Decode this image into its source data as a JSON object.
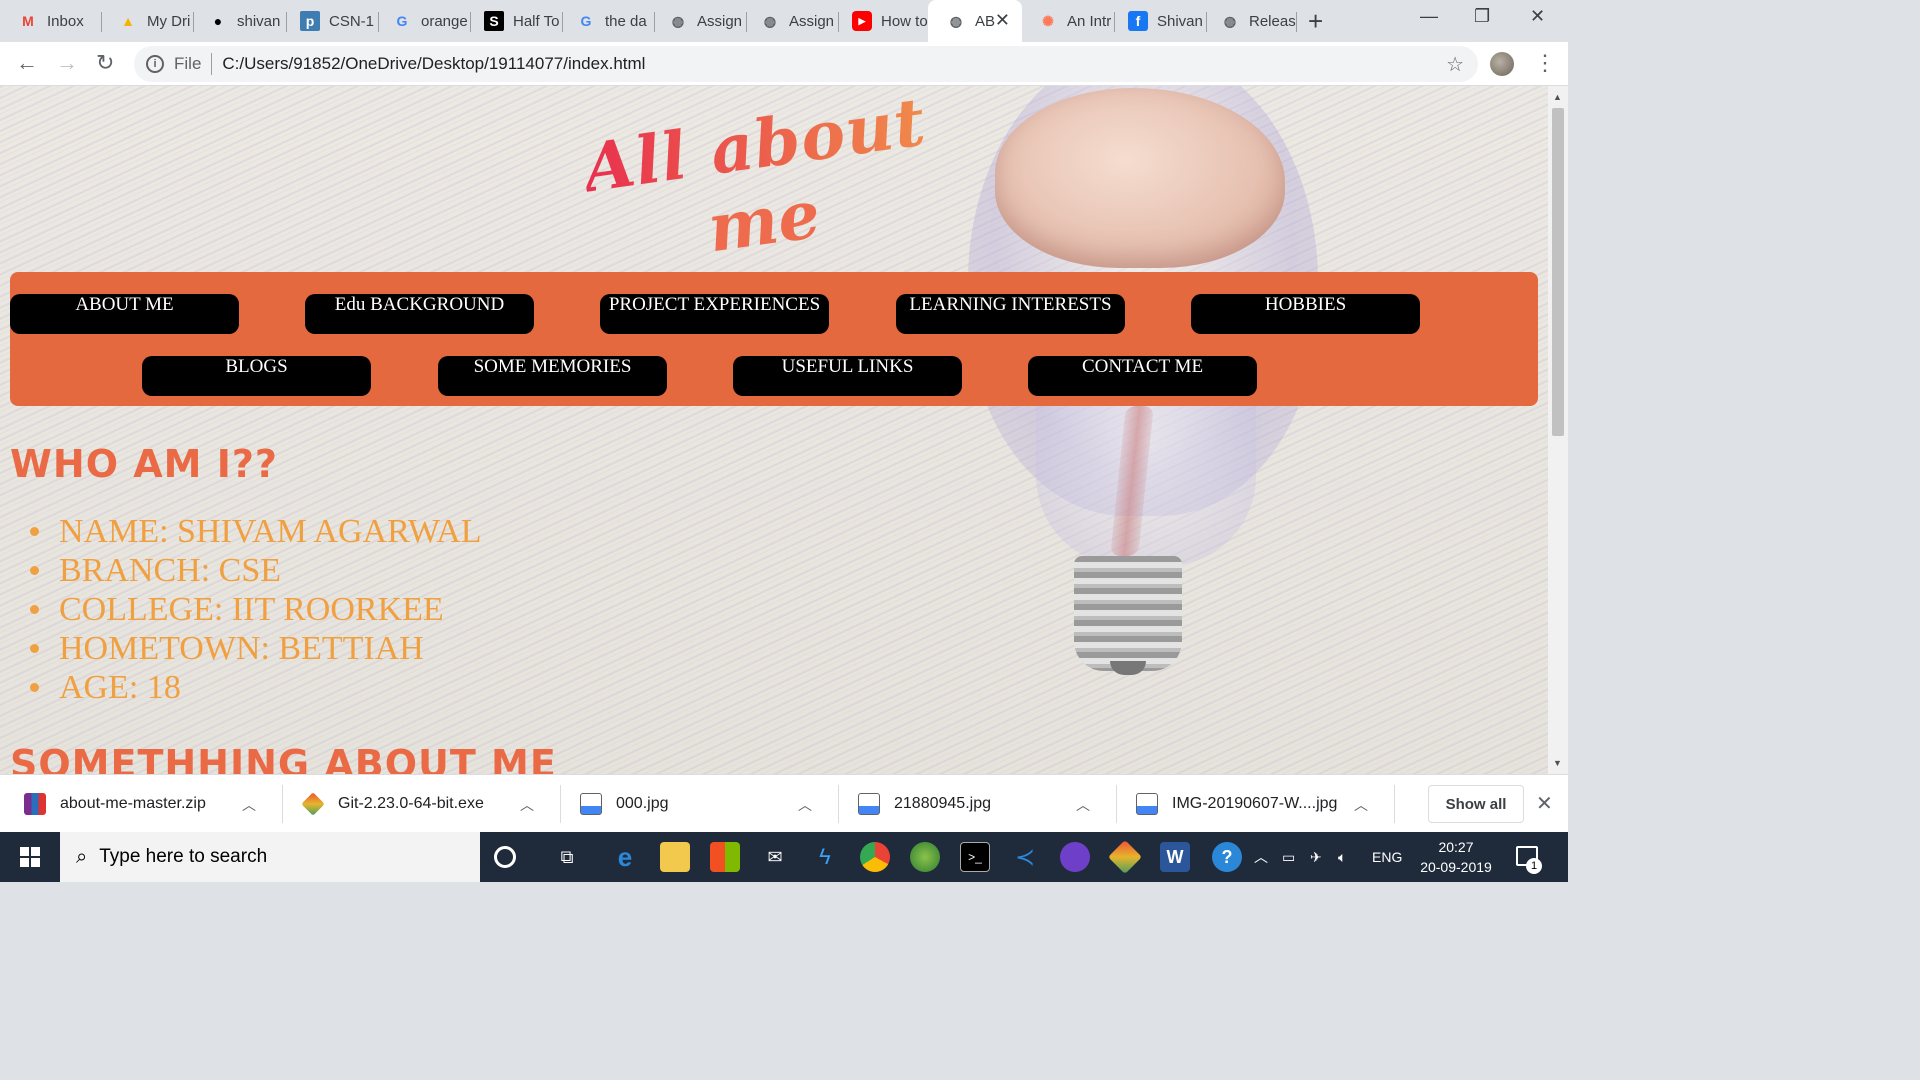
{
  "tabs": [
    {
      "label": "Inbox",
      "icon": "gmail-icon",
      "color": "#ea4335",
      "glyph": "M"
    },
    {
      "label": "My Dri",
      "icon": "drive-icon",
      "color": "#f4b400",
      "glyph": "▲"
    },
    {
      "label": "shivan",
      "icon": "github-icon",
      "color": "#000000",
      "glyph": "●"
    },
    {
      "label": "CSN-1",
      "icon": "piazza-icon",
      "color": "#3e7cb1",
      "glyph": "p"
    },
    {
      "label": "orange",
      "icon": "google-icon",
      "color": "#4285f4",
      "glyph": "G"
    },
    {
      "label": "Half To",
      "icon": "stackshare-icon",
      "color": "#000000",
      "glyph": "S"
    },
    {
      "label": "the da",
      "icon": "google-icon",
      "color": "#4285f4",
      "glyph": "G"
    },
    {
      "label": "Assign",
      "icon": "globe-icon",
      "color": "#5f6368",
      "glyph": "◍"
    },
    {
      "label": "Assign",
      "icon": "globe-icon",
      "color": "#5f6368",
      "glyph": "◍"
    },
    {
      "label": "How to",
      "icon": "youtube-icon",
      "color": "#ff0000",
      "glyph": "▶"
    },
    {
      "label": "AB",
      "icon": "globe-icon",
      "color": "#5f6368",
      "glyph": "◍"
    },
    {
      "label": "An Intr",
      "icon": "hubspot-icon",
      "color": "#ff7a59",
      "glyph": "✺"
    },
    {
      "label": "Shivan",
      "icon": "facebook-icon",
      "color": "#1877f2",
      "glyph": "f"
    },
    {
      "label": "Releas",
      "icon": "globe-icon",
      "color": "#5f6368",
      "glyph": "◍"
    }
  ],
  "address": {
    "scheme": "File",
    "url": "C:/Users/91852/OneDrive/Desktop/19114077/index.html"
  },
  "page": {
    "title_line1": "All about",
    "title_line2": "me",
    "nav": [
      "ABOUT ME",
      "Edu BACKGROUND",
      "PROJECT EXPERIENCES",
      "LEARNING INTERESTS",
      "HOBBIES",
      "BLOGS",
      "SOME MEMORIES",
      "USEFUL LINKS",
      "CONTACT ME"
    ],
    "heading_who": "WHO AM I??",
    "info": [
      "NAME: SHIVAM AGARWAL",
      "BRANCH: CSE",
      "COLLEGE: IIT ROORKEE",
      "HOMETOWN: BETTIAH",
      "AGE: 18"
    ],
    "heading_something": "SOMETHHING ABOUT ME",
    "colors": {
      "nav_bar": "#e5693f",
      "heading": "#ea6a45",
      "info_text": "#f0a040"
    }
  },
  "downloads": [
    {
      "name": "about-me-master.zip",
      "icon": "zip-icon"
    },
    {
      "name": "Git-2.23.0-64-bit.exe",
      "icon": "git-icon"
    },
    {
      "name": "000.jpg",
      "icon": "image-file-icon"
    },
    {
      "name": "21880945.jpg",
      "icon": "image-file-icon"
    },
    {
      "name": "IMG-20190607-W....jpg",
      "icon": "image-file-icon"
    }
  ],
  "show_all": "Show all",
  "taskbar": {
    "search_placeholder": "Type here to search",
    "language": "ENG",
    "time": "20:27",
    "date": "20-09-2019",
    "notification_count": "1"
  }
}
